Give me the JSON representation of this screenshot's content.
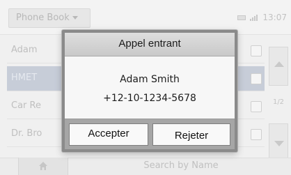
{
  "topbar": {
    "title": "Phone Book",
    "clock": "13:07"
  },
  "contacts": [
    {
      "name": "Adam"
    },
    {
      "name": "HMET"
    },
    {
      "name": "Car Re"
    },
    {
      "name": "Dr. Bro"
    }
  ],
  "pager": {
    "indicator": "1/2"
  },
  "bottombar": {
    "search_label": "Search by Name"
  },
  "dialog": {
    "title": "Appel entrant",
    "caller_name": "Adam Smith",
    "caller_number": "+12-10-1234-5678",
    "accept_label": "Accepter",
    "reject_label": "Rejeter"
  },
  "icons": {
    "dropdown": "chevron-down-icon",
    "battery": "battery-icon",
    "signal": "signal-icon",
    "home": "home-icon",
    "scroll_up": "arrow-up-icon",
    "scroll_down": "arrow-down-icon"
  }
}
